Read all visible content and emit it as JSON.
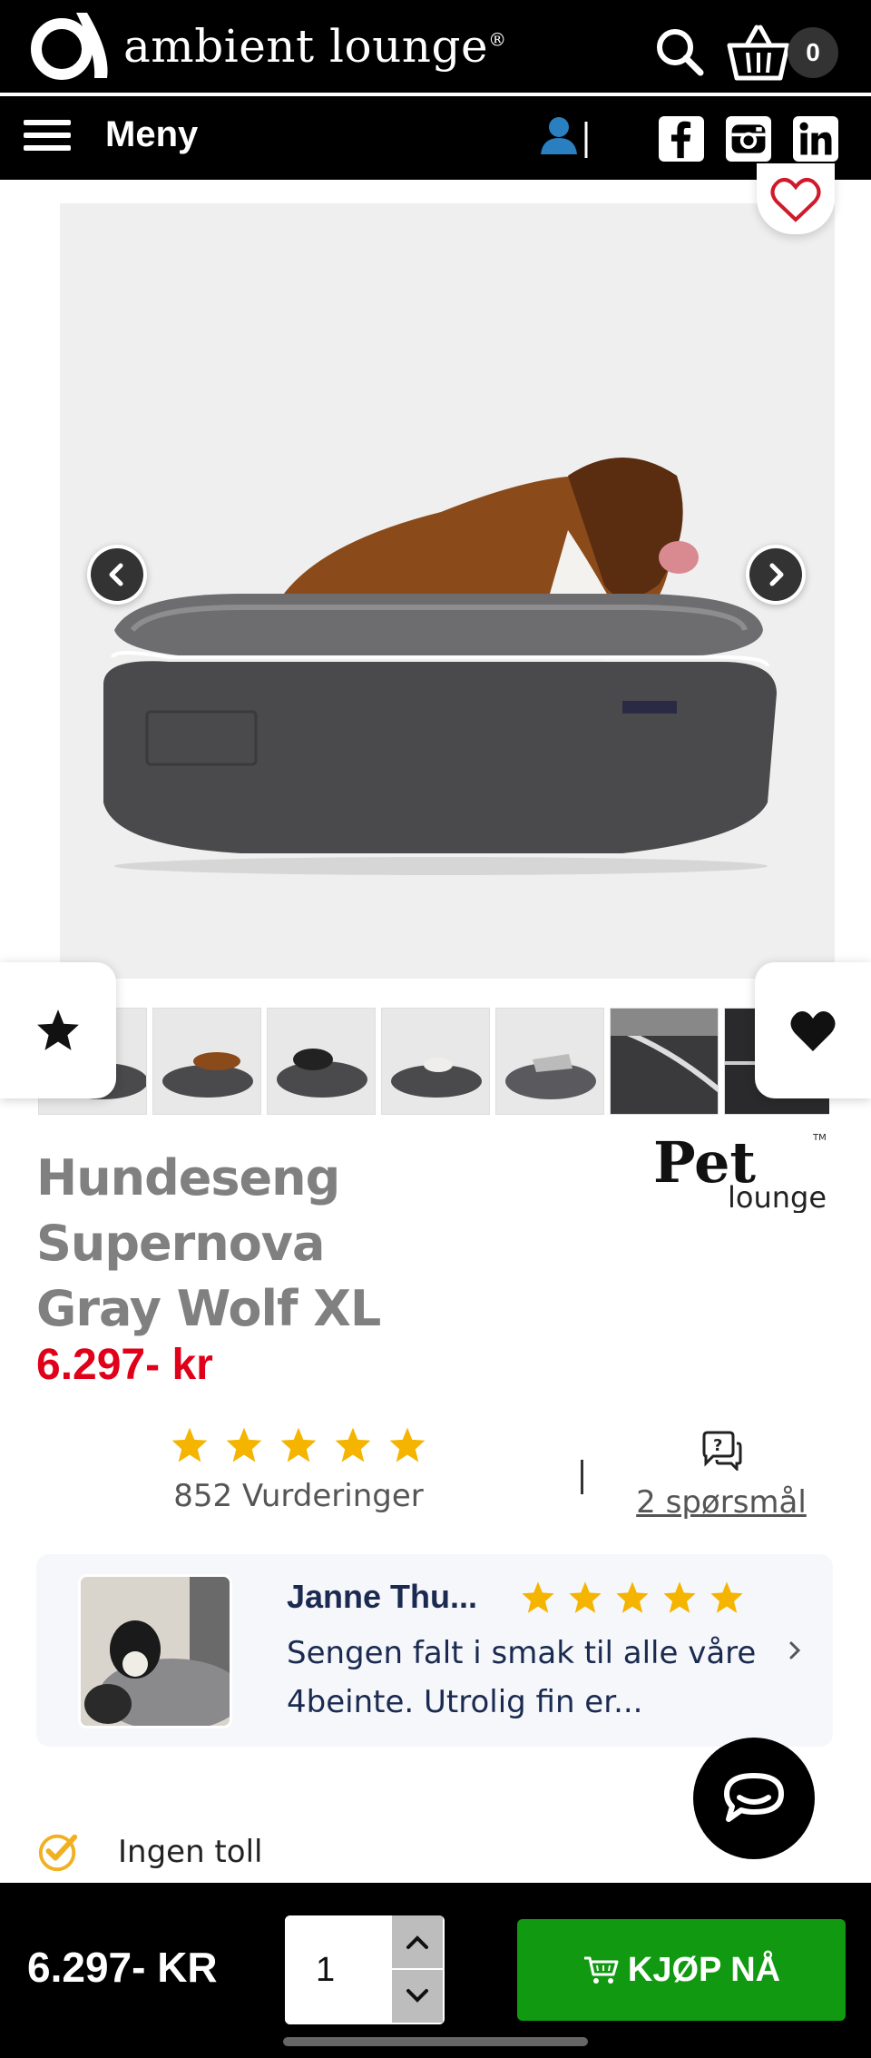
{
  "header": {
    "brand_name": "ambient lounge",
    "registered_mark": "®",
    "cart_count": "0",
    "menu_label": "Meny"
  },
  "gallery": {
    "main_image_alt": "Hundeseng Supernova Gray Wolf XL",
    "thumbnail_count": 7
  },
  "product": {
    "title_line1": "Hundeseng Supernova",
    "title_line2": "Gray Wolf XL",
    "brand_logo_text": "Pet lounge",
    "price": "6.297- kr",
    "rating_stars": 5,
    "reviews_label": "852 Vurderinger",
    "questions_label": "2 spørsmål"
  },
  "review": {
    "reviewer": "Janne Thu...",
    "stars": 5,
    "text": "Sengen falt i smak til alle våre 4beinte. Utrolig fin er..."
  },
  "benefits": [
    {
      "label": "Ingen toll"
    }
  ],
  "buybar": {
    "price": "6.297- KR",
    "quantity": "1",
    "buy_label": "KJØP NÅ"
  },
  "colors": {
    "header_bg": "#000000",
    "price_red": "#e0001a",
    "star_gold": "#f4b400",
    "buy_green": "#119a11"
  }
}
